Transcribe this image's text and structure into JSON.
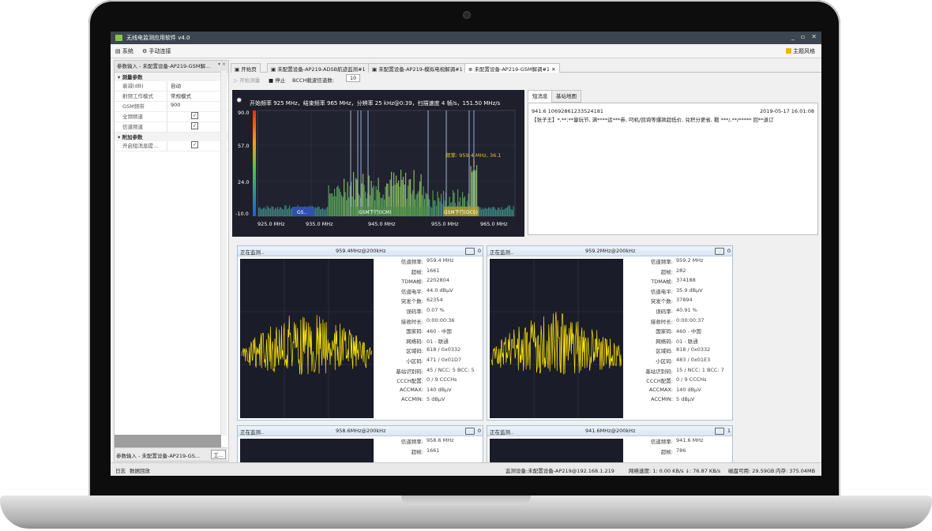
{
  "window": {
    "title": "无线电监测应用软件 v4.0",
    "controls": [
      "_",
      "▫",
      "✕"
    ]
  },
  "menu": {
    "system": "系统",
    "manual_connect": "手动连接",
    "theme": "主题风格"
  },
  "left_panel": {
    "header": "参数输入 - 未配置设备-AP219-GSM解...",
    "pin": "▾ ×",
    "group_measure": "▾ 测量参数",
    "rows": [
      {
        "key": "衰减(dB)",
        "value": "自动"
      },
      {
        "key": "射频工作模式",
        "value": "常规模式"
      },
      {
        "key": "GSM频带",
        "value": "900"
      },
      {
        "key": "全频频道",
        "value": "✓"
      },
      {
        "key": "信道频道",
        "value": "✓"
      }
    ],
    "group_extra": "▾ 附加参数",
    "extra_rows": [
      {
        "key": "开启短消息提...",
        "value": "✓"
      }
    ],
    "footer_tab": "参数输入 - 未配置设备-AP219-GS...",
    "footer_btn": "工..."
  },
  "tabs": [
    {
      "label": "开始页"
    },
    {
      "label": "未配置设备-AP219-ADSB航迹监测#1"
    },
    {
      "label": "未配置设备-AP219-模拟电视解调#1"
    },
    {
      "label": "未配置设备-AP219-GSM解调#1"
    }
  ],
  "toolbar": {
    "start": "开始测量",
    "stop": "停止",
    "bcch_label": "BCCH载波信道数:",
    "bcch_value": "10"
  },
  "spectrum": {
    "header": "开始频率 925 MHz，结束频率 965 MHz，分辨率 25 kHz@0:39，扫描速度 4 帧/s，151.50 MHz/s",
    "y_ticks": [
      "90.0",
      "57.0",
      "24.0",
      "-10.0"
    ],
    "x_ticks": [
      "925.0 MHz",
      "935.0 MHz",
      "945.0 MHz",
      "955.0 MHz",
      "965.0 MHz"
    ],
    "band_labels": [
      "GS..",
      "GSM下行(ICM)",
      "GSM下行(DCS)"
    ],
    "marker": "频率: 959.4 MHz, 36.1"
  },
  "messages": {
    "tabs": [
      "短消息",
      "基站地图"
    ],
    "line1_left": "941.6  10692861233524181",
    "line1_right": "2019-05-17 16:01:08",
    "line2": "【张子王】*,**;**量玩节, 满****运***券, 叼机/回询等爆款超低价, 兑积分更省, 戳 ***/,**/***** 回**退订"
  },
  "stat_keys": [
    "信道频率:",
    "超帧:",
    "TDMA帧:",
    "信道电平:",
    "突发个数:",
    "误码率:",
    "接收时长:",
    "国家码:",
    "网络码:",
    "区域码:",
    "小区码:",
    "基站识别码:",
    "CCCH配置:",
    "ACCMAX:",
    "ACCMIN:"
  ],
  "panels": [
    {
      "status": "正在监测..",
      "freq": "959.4MHz@200kHz",
      "count": "0",
      "values": [
        "959.4 MHz",
        "1661",
        "2202804",
        "44.0 dBμV",
        "62354",
        "0.07 %",
        "0:00:00:36",
        "460 - 中国",
        "01 - 联通",
        "818 / 0x0332",
        "471 / 0x01D7",
        "45 / NCC: 5 BCC: 5",
        "0 / 9 CCCHs",
        "140 dBμV",
        "5 dBμV"
      ]
    },
    {
      "status": "正在监测..",
      "freq": "959.2MHz@200kHz",
      "count": "0",
      "values": [
        "959.2 MHz",
        "282",
        "374188",
        "35.9 dBμV",
        "37894",
        "40.91 %",
        "0:00:00:37",
        "460 - 中国",
        "01 - 联通",
        "818 / 0x0332",
        "483 / 0x01E3",
        "15 / NCC: 1 BCC: 7",
        "0 / 9 CCCHs",
        "140 dBμV",
        "5 dBμV"
      ]
    },
    {
      "status": "正在监测..",
      "freq": "958.6MHz@200kHz",
      "count": "0",
      "values": [
        "958.6 MHz",
        "1661"
      ]
    },
    {
      "status": "正在监测..",
      "freq": "941.6MHz@200kHz",
      "count": "1",
      "values": [
        "941.6 MHz",
        "786"
      ]
    }
  ],
  "statusbar": {
    "log": "日志",
    "replay": "数据回放",
    "device": "监测设备:未配置设备-AP219@192.168.1.219",
    "net": "网络速度: 1: 0.00 KB/s ↓: 76.87 KB/s",
    "disk": "磁盘可用: 29.59GB",
    "mem": "内存: 375.04MB"
  },
  "colors": {
    "signal": "#ffe600",
    "panel_bg": "#1a1c29",
    "spectrum_bg": "#1e1f2a"
  }
}
